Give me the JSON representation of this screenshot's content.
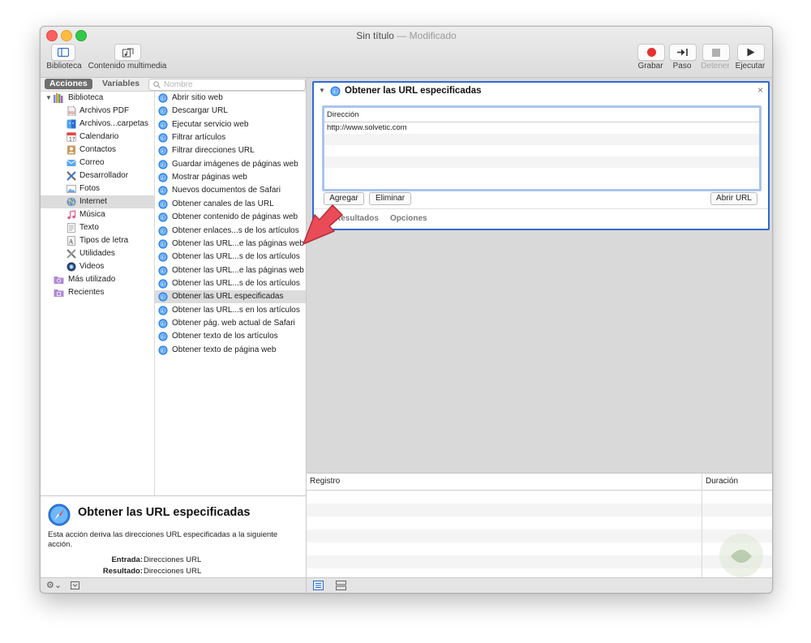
{
  "window": {
    "title": "Sin título",
    "status": "— Modificado"
  },
  "toolbar": {
    "library_label": "Biblioteca",
    "media_label": "Contenido multimedia",
    "record_label": "Grabar",
    "step_label": "Paso",
    "stop_label": "Detener",
    "run_label": "Ejecutar"
  },
  "library": {
    "tab_actions": "Acciones",
    "tab_variables": "Variables",
    "search_placeholder": "Nombre",
    "categories": [
      {
        "label": "Biblioteca",
        "icon": "library-icon"
      },
      {
        "label": "Archivos PDF",
        "icon": "pdf-icon"
      },
      {
        "label": "Archivos...carpetas",
        "icon": "finder-icon"
      },
      {
        "label": "Calendario",
        "icon": "calendar-icon"
      },
      {
        "label": "Contactos",
        "icon": "contacts-icon"
      },
      {
        "label": "Correo",
        "icon": "mail-icon"
      },
      {
        "label": "Desarrollador",
        "icon": "developer-icon"
      },
      {
        "label": "Fotos",
        "icon": "photos-icon"
      },
      {
        "label": "Internet",
        "icon": "globe-icon"
      },
      {
        "label": "Música",
        "icon": "music-icon"
      },
      {
        "label": "Texto",
        "icon": "text-icon"
      },
      {
        "label": "Tipos de letra",
        "icon": "font-icon"
      },
      {
        "label": "Utilidades",
        "icon": "utilities-icon"
      },
      {
        "label": "Videos",
        "icon": "video-icon"
      },
      {
        "label": "Más utilizado",
        "icon": "folder-icon"
      },
      {
        "label": "Recientes",
        "icon": "folder-icon"
      }
    ],
    "selected_category": "Internet",
    "actions": [
      "Abrir sitio web",
      "Descargar URL",
      "Ejecutar servicio web",
      "Filtrar artículos",
      "Filtrar direcciones URL",
      "Guardar imágenes de páginas web",
      "Mostrar páginas web",
      "Nuevos documentos de Safari",
      "Obtener canales de las URL",
      "Obtener contenido de páginas web",
      "Obtener enlaces...s de los artículos",
      "Obtener las URL...e las páginas web",
      "Obtener las URL...s de los artículos",
      "Obtener las URL...e las páginas web",
      "Obtener las URL...s de los artículos",
      "Obtener las URL especificadas",
      "Obtener las URL...s en los artículos",
      "Obtener pág. web actual de Safari",
      "Obtener texto de los artículos",
      "Obtener texto de página web"
    ],
    "selected_action": "Obtener las URL especificadas"
  },
  "info": {
    "title": "Obtener las URL especificadas",
    "description": "Esta acción deriva las direcciones URL especificadas a la siguiente acción.",
    "input_label": "Entrada:",
    "input_value": "Direcciones URL",
    "output_label": "Resultado:",
    "output_value": "Direcciones URL"
  },
  "action_card": {
    "title": "Obtener las URL especificadas",
    "column_header": "Dirección",
    "urls": [
      "http://www.solvetic.com"
    ],
    "add_label": "Agregar",
    "remove_label": "Eliminar",
    "open_label": "Abrir URL",
    "tab_results": "Resultados",
    "tab_options": "Opciones"
  },
  "log": {
    "col_log": "Registro",
    "col_duration": "Duración"
  },
  "colors": {
    "accent": "#2d6bd3",
    "record": "#e8312f",
    "arrow": "#e94b57"
  }
}
